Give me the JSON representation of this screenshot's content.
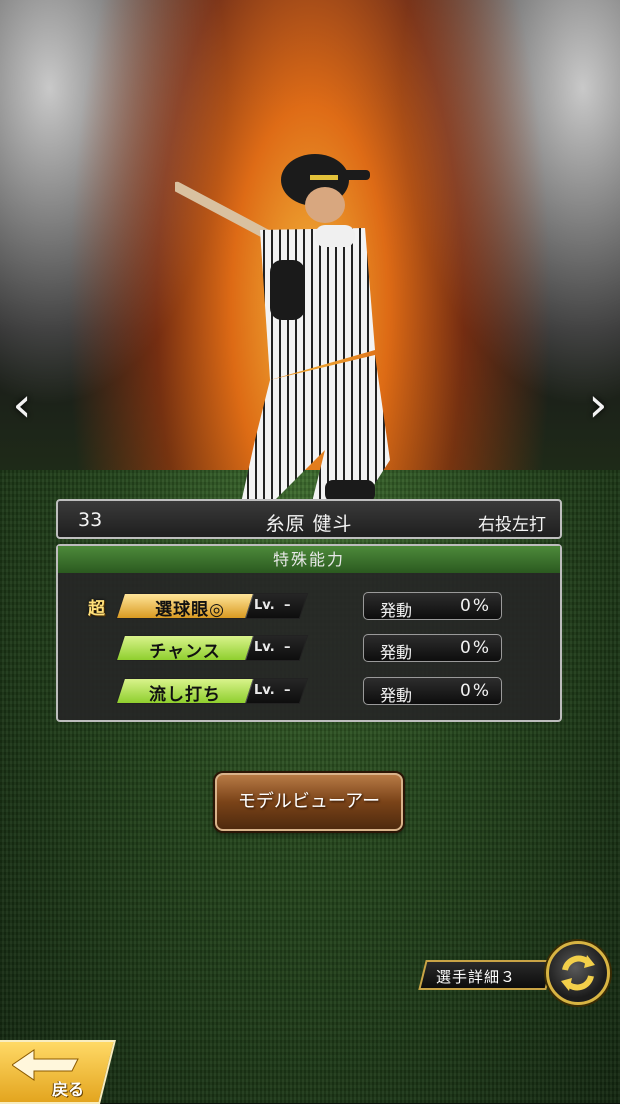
{
  "player": {
    "number": "33",
    "name": "糸原 健斗",
    "throw_bat": "右投左打"
  },
  "nav": {
    "prev_icon": "chevron-left-icon",
    "next_icon": "chevron-right-icon"
  },
  "abilities": {
    "header": "特殊能力",
    "items": [
      {
        "prefix": "超",
        "name": "選球眼◎",
        "lv_label": "Lv.",
        "lv_value": "–",
        "activation_label": "発動",
        "activation_value": "0%",
        "style": "gold"
      },
      {
        "prefix": "",
        "name": "チャンス",
        "lv_label": "Lv.",
        "lv_value": "–",
        "activation_label": "発動",
        "activation_value": "0%",
        "style": "green"
      },
      {
        "prefix": "",
        "name": "流し打ち",
        "lv_label": "Lv.",
        "lv_value": "–",
        "activation_label": "発動",
        "activation_value": "0%",
        "style": "green"
      }
    ]
  },
  "buttons": {
    "model_viewer": "モデルビューアー",
    "player_detail": "選手詳細３",
    "back": "戻る"
  },
  "colors": {
    "ability_header": "#3f7a2e",
    "skill_green": "#9fd93a",
    "skill_gold": "#e6ae35",
    "gold_accent": "#d8b443",
    "brown_button": "#7a4318"
  }
}
